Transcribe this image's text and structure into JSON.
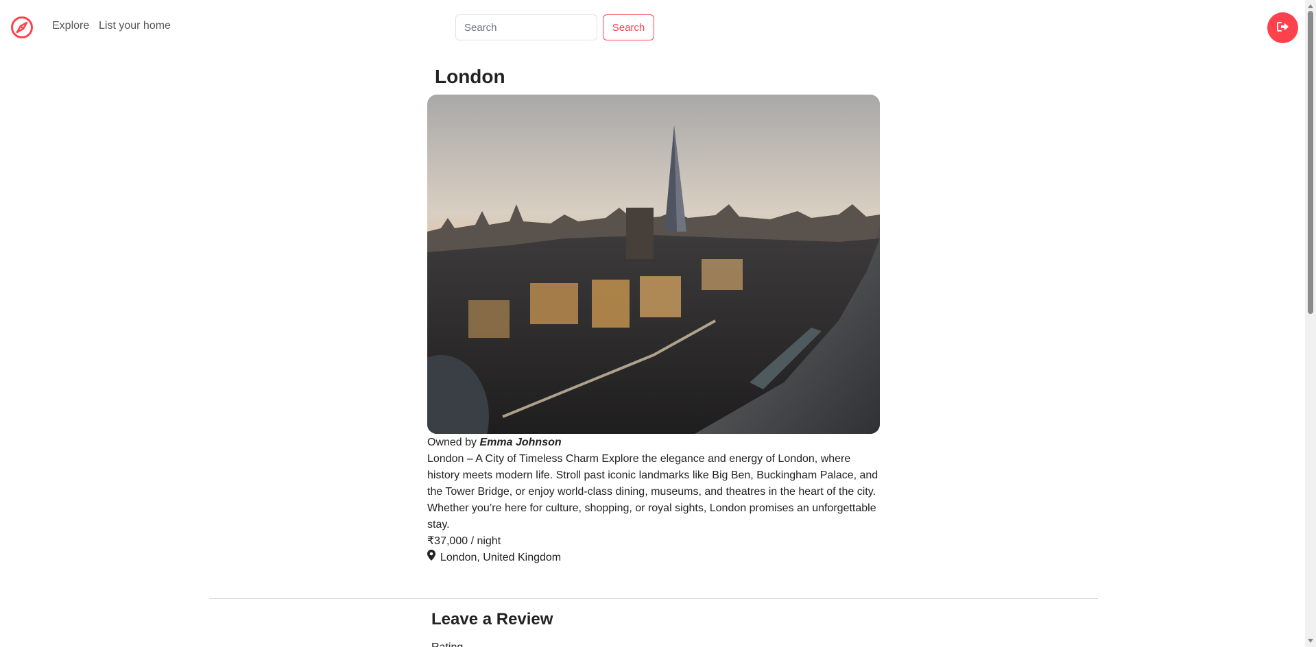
{
  "nav": {
    "explore": "Explore",
    "list_home": "List your home",
    "search_placeholder": "Search",
    "search_button": "Search"
  },
  "listing": {
    "title": "London",
    "owner_prefix": "Owned by",
    "owner_name": "Emma Johnson",
    "description": "London – A City of Timeless Charm Explore the elegance and energy of London, where history meets modern life. Stroll past iconic landmarks like Big Ben, Buckingham Palace, and the Tower Bridge, or enjoy world-class dining, museums, and theatres in the heart of the city. Whether you’re here for culture, shopping, or royal sights, London promises an unforgettable stay.",
    "price": "₹37,000 / night",
    "location": "London, United Kingdom"
  },
  "review": {
    "heading": "Leave a Review",
    "rating_label": "Rating"
  },
  "colors": {
    "accent": "#fe424d"
  },
  "icons": {
    "logo": "compass-icon",
    "logout": "sign-out-icon",
    "location": "map-pin-icon"
  }
}
